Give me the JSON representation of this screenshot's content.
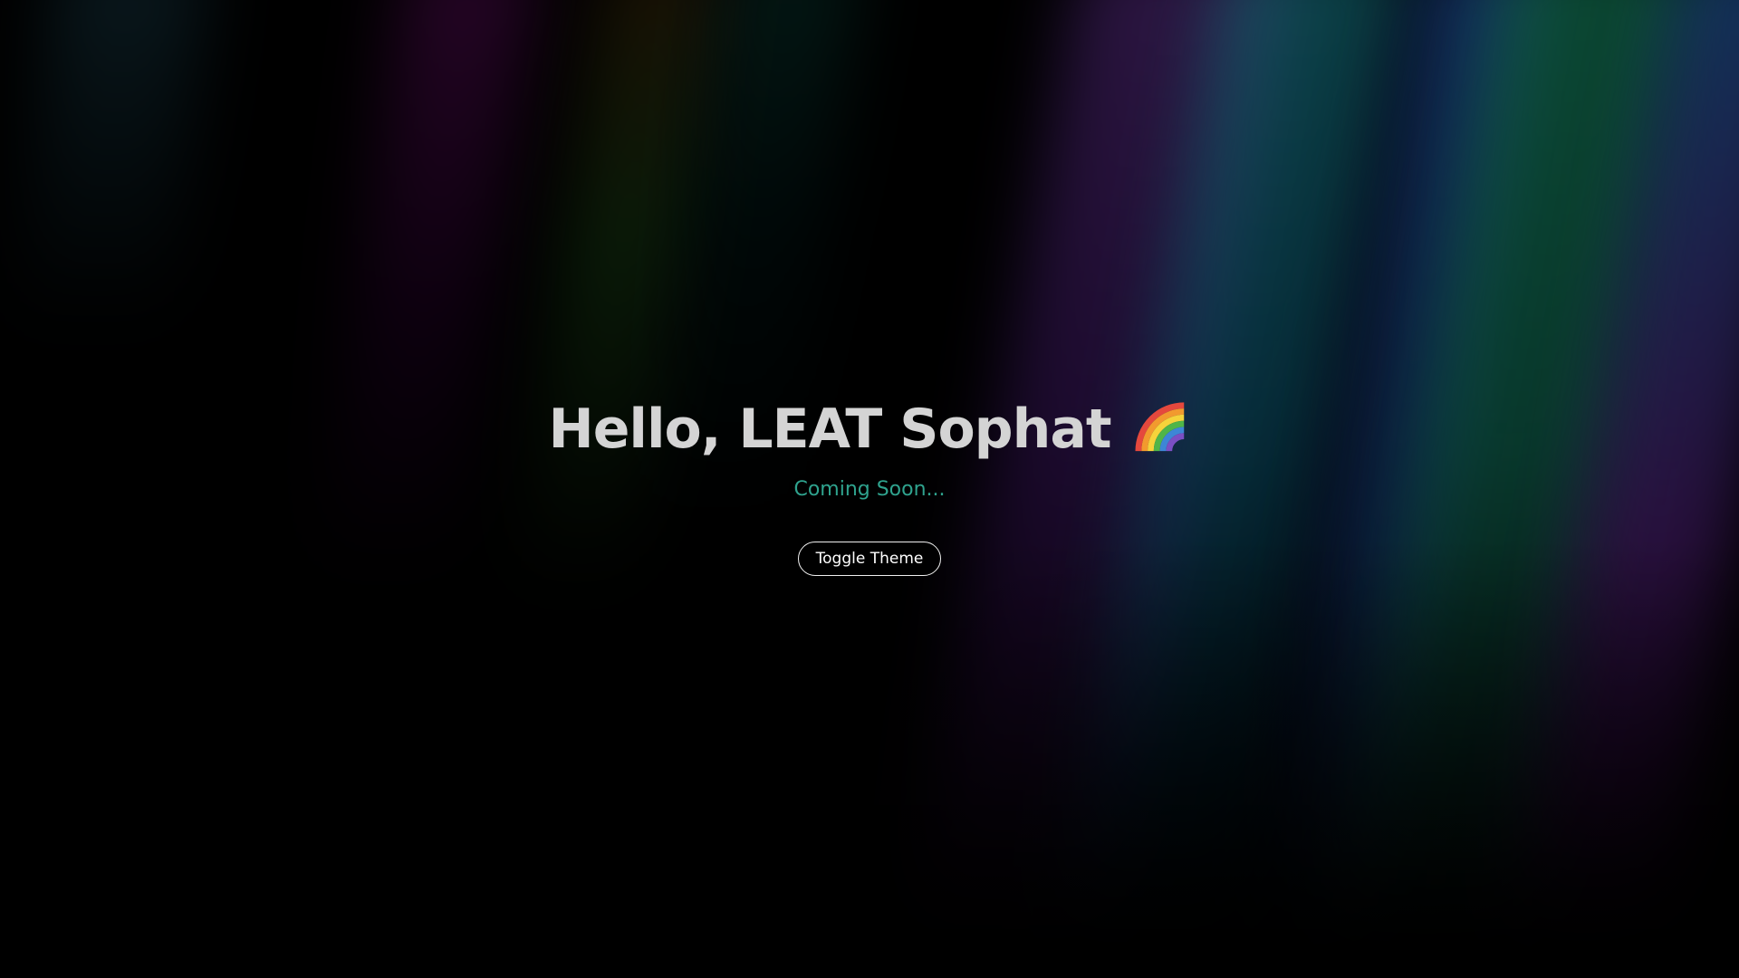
{
  "hero": {
    "title": "Hello, LEAT Sophat",
    "title_icon": "rainbow-icon",
    "subtitle": "Coming Soon...",
    "toggle_label": "Toggle Theme"
  },
  "colors": {
    "background": "#000000",
    "title": "#d4d4d4",
    "subtitle": "#2fa38e",
    "button_border": "#f0f0f0",
    "button_text": "#ffffff"
  }
}
